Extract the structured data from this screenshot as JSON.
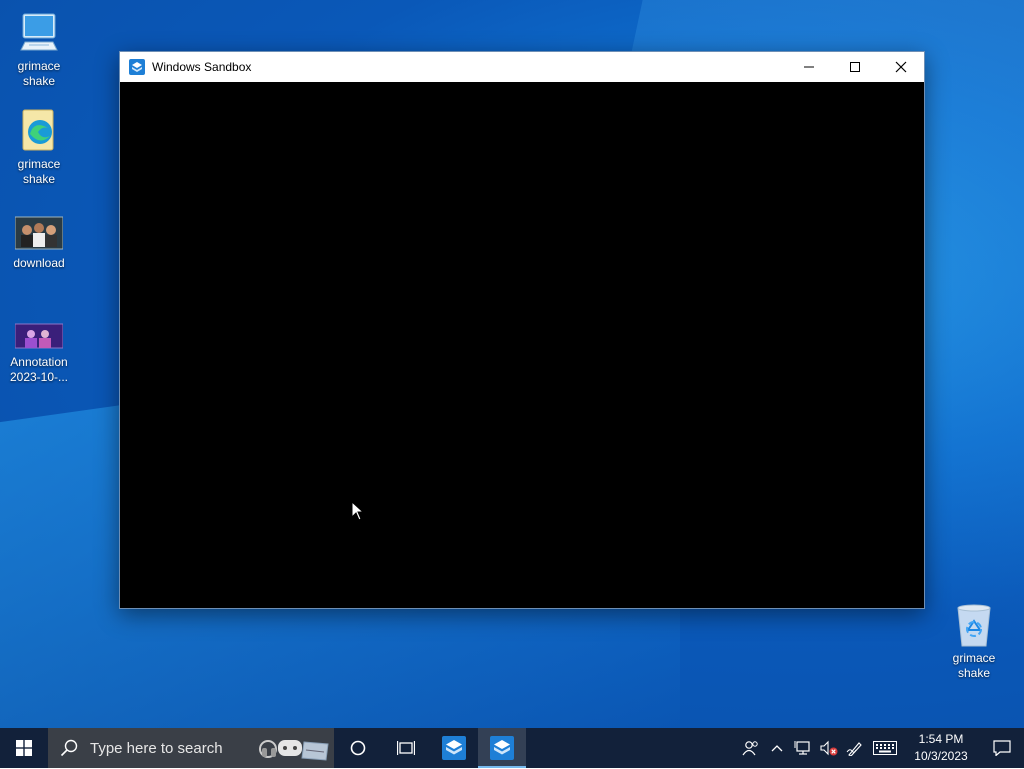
{
  "desktop": {
    "icons": [
      {
        "label": "grimace shake",
        "icon": "computer-icon"
      },
      {
        "label": "grimace shake",
        "icon": "edge-folder-icon"
      },
      {
        "label": "download",
        "icon": "image-thumbnail-icon"
      },
      {
        "label": "Annotation 2023-10-...",
        "icon": "image-thumbnail-icon"
      },
      {
        "label": "grimace shake",
        "icon": "recycle-bin-icon"
      }
    ]
  },
  "window": {
    "title": "Windows Sandbox",
    "app_icon": "sandbox-icon",
    "controls": [
      "minimize-icon",
      "maximize-icon",
      "close-icon"
    ],
    "content_color": "#000000"
  },
  "taskbar": {
    "start_icon": "windows-logo-icon",
    "search": {
      "placeholder": "Type here to search"
    },
    "cortana_icon": "cortana-circle-icon",
    "task_view_icon": "task-view-icon",
    "pinned": [
      {
        "name": "Windows Sandbox",
        "icon": "sandbox-icon",
        "active": false
      },
      {
        "name": "Windows Sandbox",
        "icon": "sandbox-icon",
        "active": true
      }
    ],
    "tray": {
      "icons": [
        "people-icon",
        "chevron-up-icon",
        "network-icon",
        "volume-muted-icon",
        "pen-icon",
        "keyboard-icon"
      ],
      "time": "1:54 PM",
      "date": "10/3/2023",
      "notification_icon": "notification-icon"
    }
  },
  "colors": {
    "taskbar_bg": "#12213a",
    "accent": "#1e7fd6",
    "desktop_blue": "#0f6fcf"
  }
}
